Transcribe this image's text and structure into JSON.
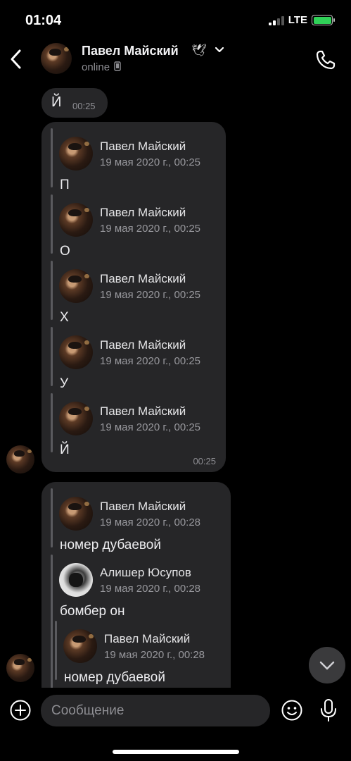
{
  "status_bar": {
    "time": "01:04",
    "network": "LTE"
  },
  "header": {
    "name": "Павел Майский",
    "name_emoji": "🕊",
    "status": "online",
    "icons": [
      "back-icon",
      "chevron-down-icon",
      "phone-device-icon",
      "phone-icon"
    ]
  },
  "messages": {
    "single": {
      "text": "Й",
      "time": "00:25"
    },
    "forward_group_1": {
      "time": "00:25",
      "items": [
        {
          "name": "Павел Майский",
          "date": "19 мая 2020 г., 00:25",
          "text": "П"
        },
        {
          "name": "Павел Майский",
          "date": "19 мая 2020 г., 00:25",
          "text": "О"
        },
        {
          "name": "Павел Майский",
          "date": "19 мая 2020 г., 00:25",
          "text": "Х"
        },
        {
          "name": "Павел Майский",
          "date": "19 мая 2020 г., 00:25",
          "text": "У"
        },
        {
          "name": "Павел Майский",
          "date": "19 мая 2020 г., 00:25",
          "text": "Й"
        }
      ]
    },
    "forward_group_2": {
      "items": [
        {
          "name": "Павел Майский",
          "date": "19 мая 2020 г., 00:28",
          "text": "номер дубаевой"
        },
        {
          "name": "Алишер Юсупов",
          "date": "19 мая 2020 г., 00:28",
          "text": "бомбер он"
        }
      ],
      "nested": {
        "name": "Павел Майский",
        "date": "19 мая 2020 г., 00:28",
        "text": "номер дубаевой"
      }
    }
  },
  "input_bar": {
    "placeholder": "Сообщение",
    "icons": [
      "plus-icon",
      "emoji-icon",
      "microphone-icon",
      "chevron-down-icon"
    ]
  },
  "colors": {
    "background": "#000000",
    "bubble": "#262628",
    "battery": "#30d158",
    "secondary_text": "#8e8e93"
  }
}
